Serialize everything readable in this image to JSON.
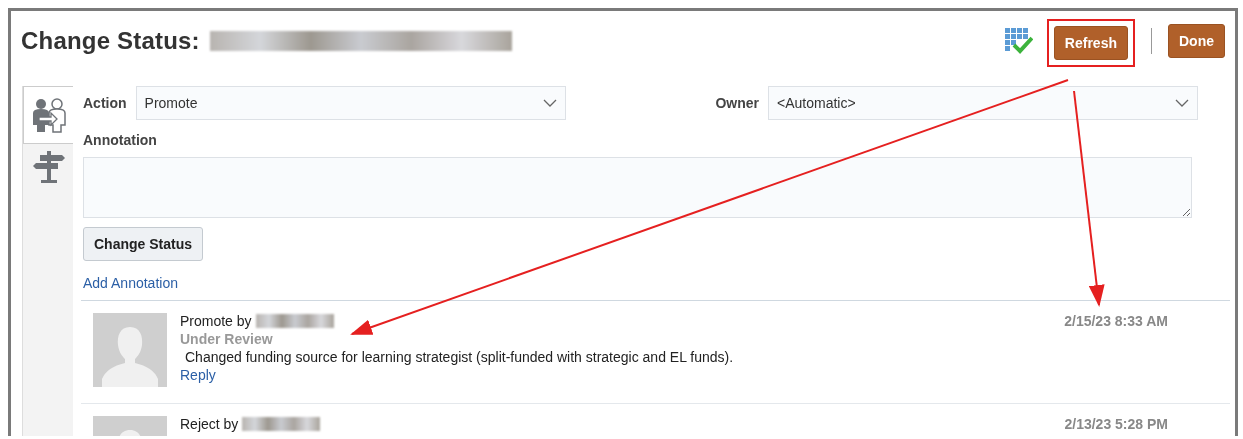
{
  "header": {
    "title": "Change Status:",
    "buttons": [
      {
        "label": "Refresh",
        "kind": "primary",
        "highlighted": true
      },
      {
        "label": "Done",
        "kind": "primary",
        "highlighted": false
      }
    ]
  },
  "side_tabs": [
    {
      "kind": "people",
      "selected": true
    },
    {
      "kind": "signpost",
      "selected": false
    }
  ],
  "form": {
    "action": {
      "label": "Action",
      "value": "Promote"
    },
    "owner": {
      "label": "Owner",
      "value": "<Automatic>"
    },
    "annotation": {
      "label": "Annotation"
    },
    "submit": "Change Status",
    "add_link": "Add Annotation"
  },
  "entries": [
    {
      "title": "Promote by",
      "date": "2/15/23 8:33 AM",
      "status": "Under Review",
      "comment": "Changed funding source for learning strategist (split-funded with strategic and EL funds).",
      "reply": "Reply"
    },
    {
      "title": "Reject by",
      "date": "2/13/23 5:28 PM"
    }
  ]
}
